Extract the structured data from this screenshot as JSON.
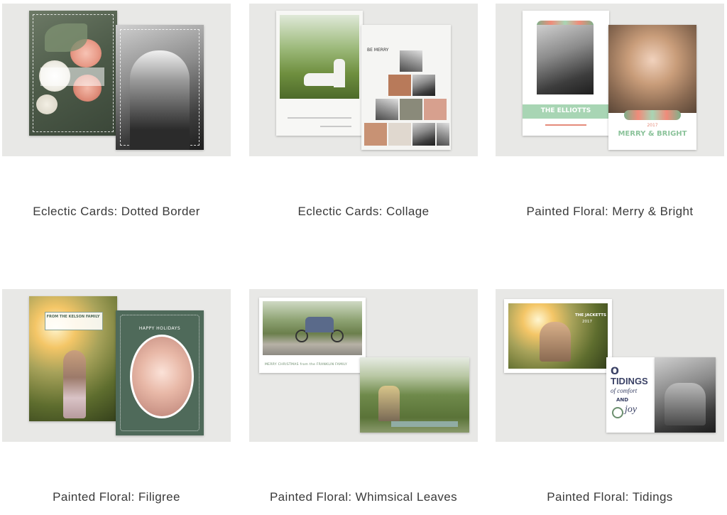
{
  "products": [
    {
      "title": "Eclectic Cards: Dotted Border",
      "card_text": []
    },
    {
      "title": "Eclectic Cards: Collage",
      "card_text": [
        "BE MERRY"
      ]
    },
    {
      "title": "Painted Floral: Merry & Bright",
      "card_text": [
        "THE ELLIOTTS",
        "2017",
        "MERRY & BRIGHT"
      ]
    },
    {
      "title": "Painted Floral: Filigree",
      "card_text": [
        "FROM THE KELSON FAMILY",
        "HAPPY HOLIDAYS"
      ]
    },
    {
      "title": "Painted Floral: Whimsical Leaves",
      "card_text": [
        "MERRY CHRISTMAS from the FRANKLIN FAMILY"
      ]
    },
    {
      "title": "Painted Floral: Tidings",
      "card_text": [
        "THE JACKETTS",
        "2017",
        "O",
        "TIDINGS",
        "of comfort",
        "AND",
        "joy"
      ]
    }
  ],
  "colors": {
    "background": "#ffffff",
    "tile_bg": "#e8e8e6",
    "mint": "#a8d5b4",
    "forest": "#4f6a5a",
    "navy": "#3b4266"
  }
}
